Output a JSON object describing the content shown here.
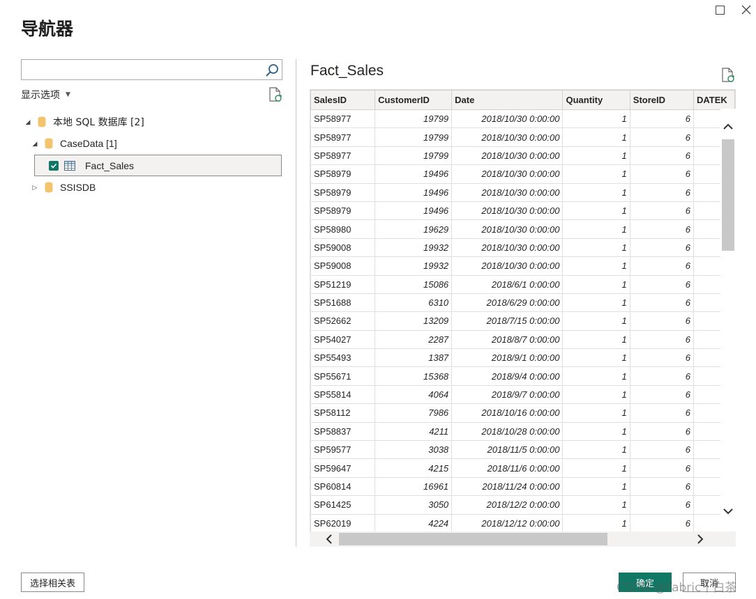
{
  "dialog": {
    "title": "导航器",
    "window_controls": {
      "maximize_icon": "maximize-icon",
      "close_icon": "close-icon"
    }
  },
  "left_pane": {
    "search": {
      "value": "",
      "placeholder": ""
    },
    "display_options_label": "显示选项",
    "tree": {
      "root": {
        "label": "本地 SQL 数据库 [2]",
        "expanded": true
      },
      "casedata": {
        "label": "CaseData [1]",
        "expanded": true
      },
      "fact_sales": {
        "label": "Fact_Sales",
        "checked": true,
        "selected": true
      },
      "ssisdb": {
        "label": "SSISDB",
        "expanded": false
      }
    }
  },
  "preview": {
    "title": "Fact_Sales",
    "columns": [
      "SalesID",
      "CustomerID",
      "Date",
      "Quantity",
      "StoreID",
      "DATEK"
    ],
    "rows": [
      [
        "SP58977",
        "19799",
        "2018/10/30 0:00:00",
        "1",
        "6",
        ""
      ],
      [
        "SP58977",
        "19799",
        "2018/10/30 0:00:00",
        "1",
        "6",
        ""
      ],
      [
        "SP58977",
        "19799",
        "2018/10/30 0:00:00",
        "1",
        "6",
        ""
      ],
      [
        "SP58979",
        "19496",
        "2018/10/30 0:00:00",
        "1",
        "6",
        ""
      ],
      [
        "SP58979",
        "19496",
        "2018/10/30 0:00:00",
        "1",
        "6",
        ""
      ],
      [
        "SP58979",
        "19496",
        "2018/10/30 0:00:00",
        "1",
        "6",
        ""
      ],
      [
        "SP58980",
        "19629",
        "2018/10/30 0:00:00",
        "1",
        "6",
        ""
      ],
      [
        "SP59008",
        "19932",
        "2018/10/30 0:00:00",
        "1",
        "6",
        ""
      ],
      [
        "SP59008",
        "19932",
        "2018/10/30 0:00:00",
        "1",
        "6",
        ""
      ],
      [
        "SP51219",
        "15086",
        "2018/6/1 0:00:00",
        "1",
        "6",
        ""
      ],
      [
        "SP51688",
        "6310",
        "2018/6/29 0:00:00",
        "1",
        "6",
        ""
      ],
      [
        "SP52662",
        "13209",
        "2018/7/15 0:00:00",
        "1",
        "6",
        ""
      ],
      [
        "SP54027",
        "2287",
        "2018/8/7 0:00:00",
        "1",
        "6",
        ""
      ],
      [
        "SP55493",
        "1387",
        "2018/9/1 0:00:00",
        "1",
        "6",
        ""
      ],
      [
        "SP55671",
        "15368",
        "2018/9/4 0:00:00",
        "1",
        "6",
        ""
      ],
      [
        "SP55814",
        "4064",
        "2018/9/7 0:00:00",
        "1",
        "6",
        ""
      ],
      [
        "SP58112",
        "7986",
        "2018/10/16 0:00:00",
        "1",
        "6",
        ""
      ],
      [
        "SP58837",
        "4211",
        "2018/10/28 0:00:00",
        "1",
        "6",
        ""
      ],
      [
        "SP59577",
        "3038",
        "2018/11/5 0:00:00",
        "1",
        "6",
        ""
      ],
      [
        "SP59647",
        "4215",
        "2018/11/6 0:00:00",
        "1",
        "6",
        ""
      ],
      [
        "SP60814",
        "16961",
        "2018/11/24 0:00:00",
        "1",
        "6",
        ""
      ],
      [
        "SP61425",
        "3050",
        "2018/12/2 0:00:00",
        "1",
        "6",
        ""
      ],
      [
        "SP62019",
        "4224",
        "2018/12/12 0:00:00",
        "1",
        "6",
        ""
      ]
    ]
  },
  "footer": {
    "select_related_label": "选择相关表",
    "ok_label": "确定",
    "cancel_label": "取消"
  },
  "watermark": "CSDN @Fabric丨白茶",
  "colors": {
    "accent": "#117865",
    "header_bg": "#f3f2f1",
    "border": "#e1dfdd"
  }
}
